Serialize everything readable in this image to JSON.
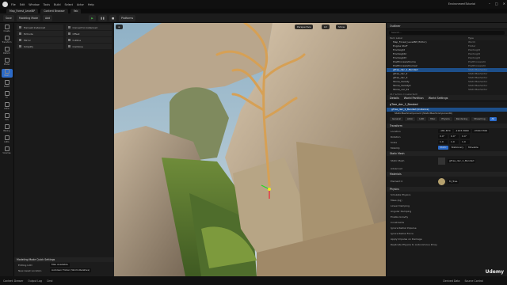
{
  "menubar": {
    "items": [
      "File",
      "Edit",
      "Window",
      "Tools",
      "Build",
      "Select",
      "Actor",
      "Help"
    ],
    "project": "EnvironmentTutorial"
  },
  "tabs": [
    "Map_Forest_LevelBP",
    "Content Browser",
    "Fab"
  ],
  "toolbar": {
    "buttons": [
      "Save",
      "Modeling Mode",
      "Add",
      "Play",
      "Pause",
      "Stop",
      "Platforms"
    ]
  },
  "rail": [
    "Create",
    "Transform",
    "Deform",
    "Model",
    "Mesh",
    "Select",
    "Tri",
    "Attrib",
    "UVs",
    "Baking",
    "LODs",
    "Volumes"
  ],
  "modes": {
    "items": [
      "Harvest Instanced",
      "Convert to Instanced",
      "Extrude",
      "Offset",
      "Mirror",
      "Cutline",
      "Simplify",
      "Combine",
      "Remesh",
      "Subdivide",
      "Solidify",
      "Weld Edges"
    ]
  },
  "viewport": {
    "tools": [
      "Perspective",
      "Lit",
      "Show"
    ]
  },
  "outliner": {
    "title": "Outliner",
    "search_placeholder": "Search...",
    "col_label": "Item Label",
    "col_type": "Type",
    "rows": [
      {
        "label": "Map_Forest_LevelBP (Editor)",
        "type": "World"
      },
      {
        "label": "Engine Stuff",
        "type": "Folder"
      },
      {
        "label": "FrontLight",
        "type": "PointLight"
      },
      {
        "label": "FrontLight2",
        "type": "PointLight"
      },
      {
        "label": "FrontLight3",
        "type": "PointLight"
      },
      {
        "label": "PostProcessVolume",
        "type": "PostProcessVol"
      },
      {
        "label": "PostProcessVolume2",
        "type": "PostProcessVol"
      },
      {
        "label": "gTree_dec_1_Bended",
        "type": "StaticMeshActor",
        "selected": true
      },
      {
        "label": "gTree_dec_2",
        "type": "StaticMeshActor"
      },
      {
        "label": "gTree_dec_3",
        "type": "StaticMeshActor"
      },
      {
        "label": "Stone_Variety",
        "type": "StaticMeshActor"
      },
      {
        "label": "Stone_Variety2",
        "type": "StaticMeshActor"
      },
      {
        "label": "Stone_var_01",
        "type": "StaticMeshActor"
      }
    ],
    "count": "217 actors (1 selected)"
  },
  "details": {
    "title": "Details",
    "tab2": "World Partition",
    "tab3": "World Settings",
    "actor": "gTree_dec_1_Bended",
    "component": "gTree_dec_1_Bended (Instance)",
    "subcomponent": "StaticMeshComponent (StaticMeshComponent0)",
    "categories": [
      "General",
      "Actor",
      "LOD",
      "Misc",
      "Physics",
      "Rendering",
      "Streaming",
      "All"
    ],
    "transform_section": "Transform",
    "location_label": "Location",
    "location": [
      "-181.870",
      "-1103.3660",
      "-3300.5766"
    ],
    "rotation_label": "Rotation",
    "rotation": [
      "0.0°",
      "0.0°",
      "0.0°"
    ],
    "scale_label": "Scale",
    "scale": [
      "1.0",
      "1.0",
      "1.0"
    ],
    "mobility_label": "Mobility",
    "mobility": [
      "Static",
      "Stationary",
      "Movable"
    ],
    "static_mesh_section": "Static Mesh",
    "static_mesh_label": "Static Mesh",
    "static_mesh_value": "gTree_dec_1_Bended",
    "advanced_label": "Advanced",
    "materials_section": "Materials",
    "element_label": "Element 0",
    "element_value": "M_Tree",
    "physics_section": "Physics",
    "physics_rows": [
      "Simulate Physics",
      "Mass (kg)",
      "Linear Damping",
      "Angular Damping",
      "Enable Gravity",
      "Constraints",
      "Ignore Radial Impulse",
      "Ignore Radial Force",
      "Apply Impulse on Damage",
      "Replicate Physics to Autonomous Proxy"
    ]
  },
  "bottom_panel": {
    "title": "Modeling Mode Quick Settings",
    "row1_label": "Editing LOD",
    "row1_value": "Max Available",
    "row2_label": "New Asset Location",
    "row2_value": "AutoGen Folder (World-Relative)"
  },
  "status": [
    "Content Drawer",
    "Output Log",
    "Cmd",
    "Derived Data",
    "Source Control"
  ],
  "watermark": "Udemy"
}
